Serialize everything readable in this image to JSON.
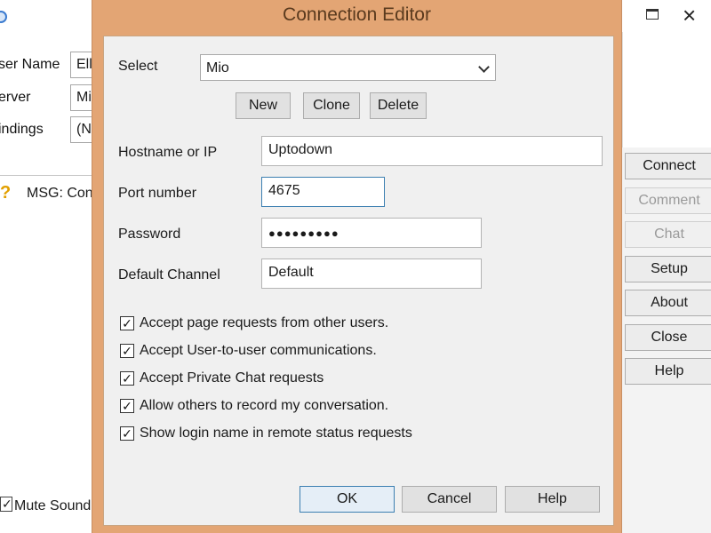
{
  "background_window": {
    "fields": [
      {
        "label": "ser Name",
        "value": "Ell"
      },
      {
        "label": "erver",
        "value": "Mi"
      },
      {
        "label": "indings",
        "value": "(N"
      }
    ],
    "message": "MSG: Con",
    "mute_label": "Mute Sound",
    "mute_checked": "✓",
    "side_buttons": [
      {
        "label": "Connect",
        "enabled": true
      },
      {
        "label": "Comment",
        "enabled": false
      },
      {
        "label": "Chat",
        "enabled": false
      },
      {
        "label": "Setup",
        "enabled": true
      },
      {
        "label": "About",
        "enabled": true
      },
      {
        "label": "Close",
        "enabled": true
      },
      {
        "label": "Help",
        "enabled": true
      }
    ],
    "close_glyph": "×"
  },
  "dialog": {
    "title": "Connection Editor",
    "select_label": "Select",
    "select_value": "Mio",
    "profile_buttons": {
      "new": "New",
      "clone": "Clone",
      "delete": "Delete"
    },
    "fields": {
      "hostname_label": "Hostname or IP",
      "hostname_value": "Uptodown",
      "port_label": "Port number",
      "port_value": "4675",
      "password_label": "Password",
      "password_value": "●●●●●●●●●",
      "channel_label": "Default Channel",
      "channel_value": "Default"
    },
    "options": [
      {
        "label": "Accept page requests from other users.",
        "checked": "✓"
      },
      {
        "label": "Accept User-to-user communications.",
        "checked": "✓"
      },
      {
        "label": "Accept Private Chat requests",
        "checked": "✓"
      },
      {
        "label": "Allow others to record my conversation.",
        "checked": "✓"
      },
      {
        "label": "Show login name in remote status requests",
        "checked": "✓"
      }
    ],
    "footer_buttons": {
      "ok": "OK",
      "cancel": "Cancel",
      "help": "Help"
    }
  },
  "colors": {
    "dialog_frame": "#e3a574",
    "focus_border": "#3c7fb1"
  }
}
